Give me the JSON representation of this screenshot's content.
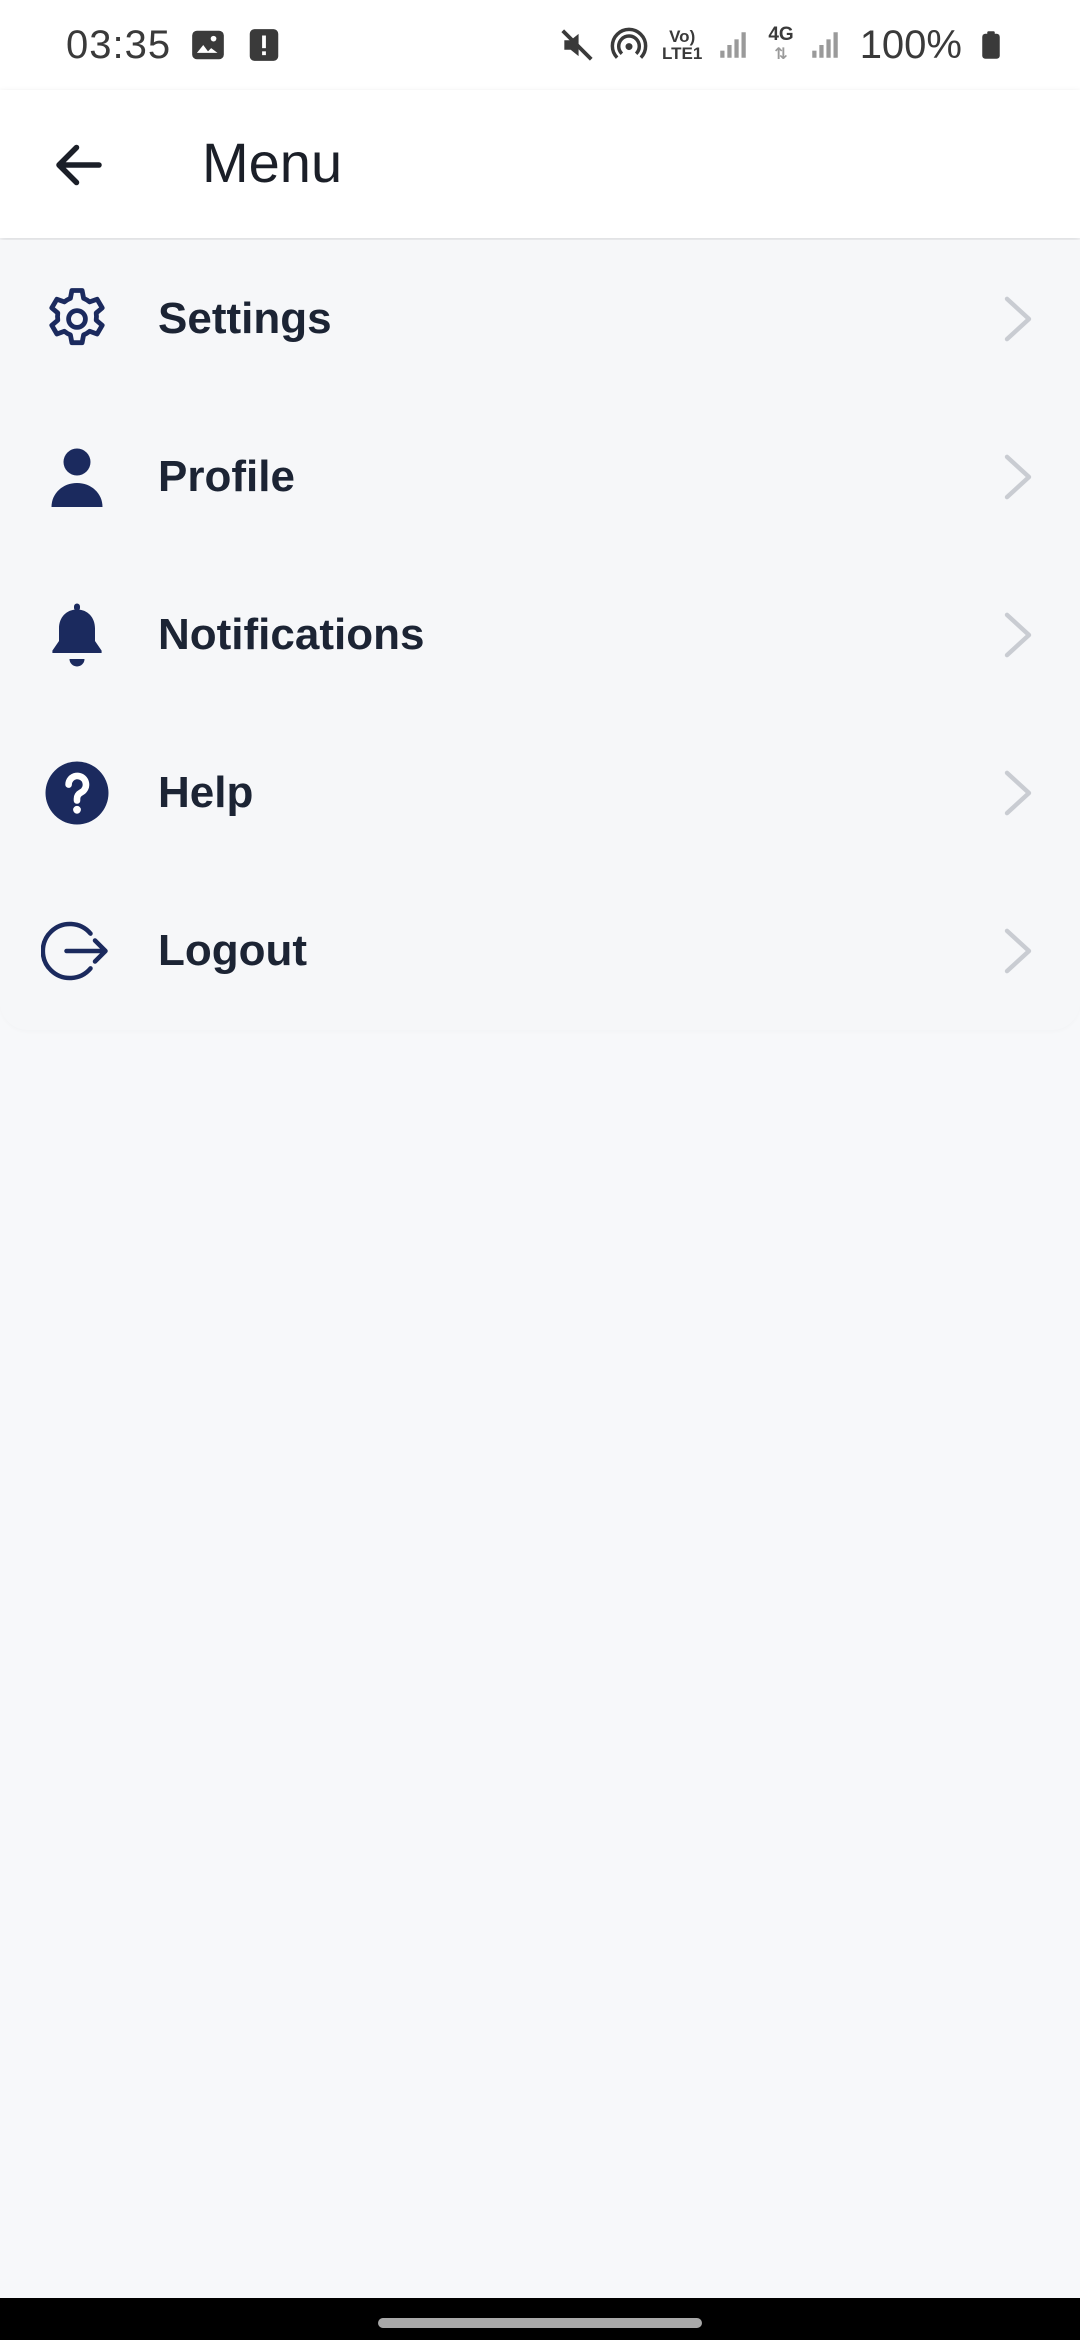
{
  "status_bar": {
    "time": "03:35",
    "battery": "100%",
    "icons": [
      "gallery-icon",
      "alert-icon",
      "mute-icon",
      "hotspot-icon",
      "volte-icon",
      "signal-icon",
      "4g-icon",
      "signal-icon",
      "battery-icon"
    ],
    "volte_label_top": "Vo)",
    "volte_label_bottom": "LTE1",
    "network_label": "4G"
  },
  "app_bar": {
    "title": "Menu",
    "back_icon": "arrow-left-icon"
  },
  "menu": {
    "items": [
      {
        "label": "Settings",
        "icon": "gear-icon"
      },
      {
        "label": "Profile",
        "icon": "person-icon"
      },
      {
        "label": "Notifications",
        "icon": "bell-icon"
      },
      {
        "label": "Help",
        "icon": "question-circle-icon"
      },
      {
        "label": "Logout",
        "icon": "logout-icon"
      }
    ]
  },
  "colors": {
    "icon": "#1b2a5e",
    "text": "#1c2434",
    "chevron": "#c9ccd2",
    "background": "#f7f8fa",
    "app_bar": "#ffffff"
  }
}
